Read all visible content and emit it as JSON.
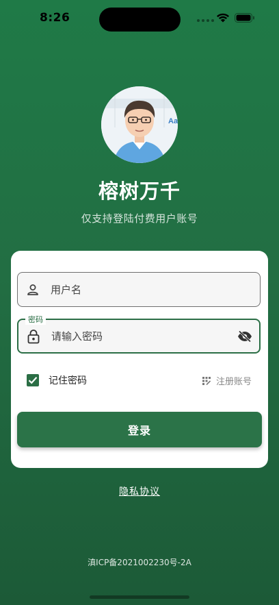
{
  "status_bar": {
    "time": "8:26"
  },
  "header": {
    "app_title": "榕树万千",
    "subtitle": "仅支持登陆付费用户账号",
    "avatar_badge": "Aa"
  },
  "login_form": {
    "username": {
      "placeholder": "用户名",
      "value": ""
    },
    "password": {
      "label": "密码",
      "placeholder": "请输入密码",
      "value": ""
    },
    "remember_label": "记住密码",
    "remember_checked": true,
    "register_label": "注册账号",
    "login_button": "登录"
  },
  "footer": {
    "privacy_link": "隐私协议",
    "icp": "滇ICP备2021002230号-2A"
  },
  "colors": {
    "background": "#226e43",
    "accent": "#2b7348",
    "card": "#ffffff"
  },
  "icons": [
    "wifi-icon",
    "battery-icon",
    "person-icon",
    "lock-icon",
    "eye-off-icon",
    "check-icon",
    "register-icon"
  ]
}
